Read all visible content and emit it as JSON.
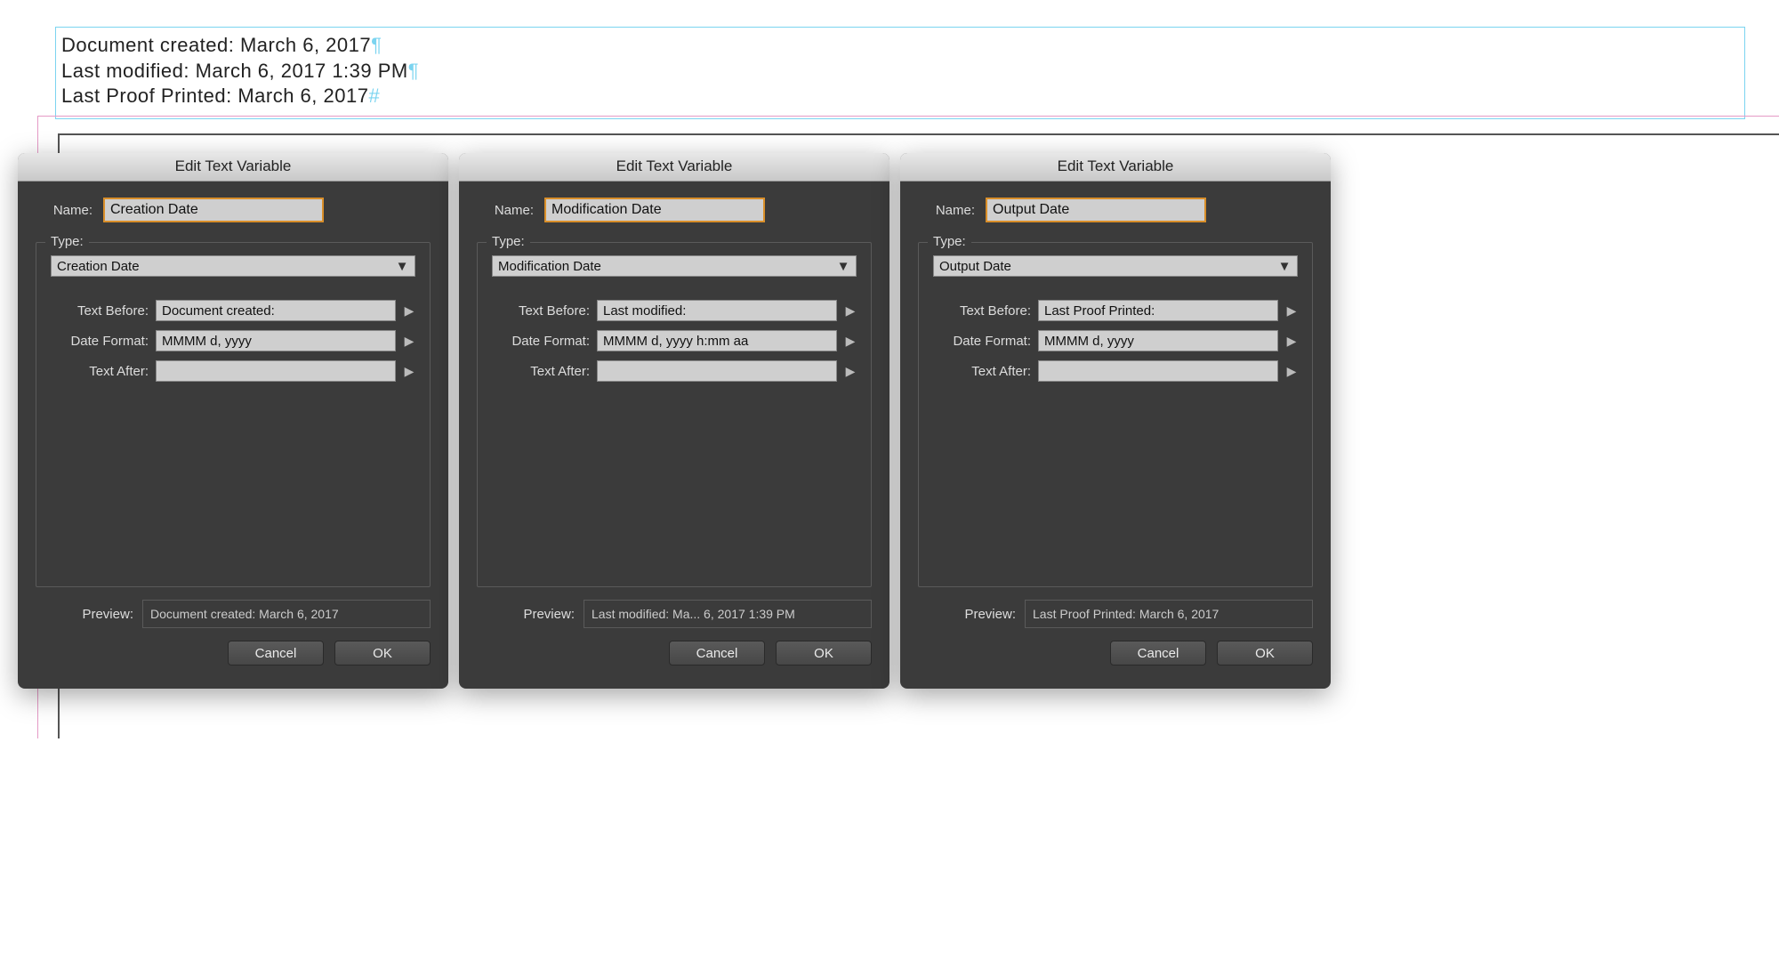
{
  "document": {
    "line1": "Document created: March 6, 2017",
    "line2": "Last modified: March 6, 2017 1:39 PM",
    "line3": "Last Proof Printed: March 6, 2017",
    "pilcrow": "¶",
    "end_mark": "#"
  },
  "dialogs": [
    {
      "title": "Edit Text Variable",
      "name_label": "Name:",
      "name_value": "Creation Date",
      "type_label": "Type:",
      "type_value": "Creation Date",
      "text_before_label": "Text Before:",
      "text_before_value": "Document created: ",
      "date_format_label": "Date Format:",
      "date_format_value": "MMMM d, yyyy",
      "text_after_label": "Text After:",
      "text_after_value": "",
      "preview_label": "Preview:",
      "preview_value": "Document created: March 6, 2017",
      "cancel": "Cancel",
      "ok": "OK"
    },
    {
      "title": "Edit Text Variable",
      "name_label": "Name:",
      "name_value": "Modification Date",
      "type_label": "Type:",
      "type_value": "Modification Date",
      "text_before_label": "Text Before:",
      "text_before_value": "Last modified: ",
      "date_format_label": "Date Format:",
      "date_format_value": "MMMM d, yyyy h:mm aa",
      "text_after_label": "Text After:",
      "text_after_value": "",
      "preview_label": "Preview:",
      "preview_value": "Last modified: Ma... 6, 2017 1:39 PM",
      "cancel": "Cancel",
      "ok": "OK"
    },
    {
      "title": "Edit Text Variable",
      "name_label": "Name:",
      "name_value": "Output Date",
      "type_label": "Type:",
      "type_value": "Output Date",
      "text_before_label": "Text Before:",
      "text_before_value": "Last Proof Printed: ",
      "date_format_label": "Date Format:",
      "date_format_value": "MMMM d, yyyy",
      "text_after_label": "Text After:",
      "text_after_value": "",
      "preview_label": "Preview:",
      "preview_value": "Last Proof Printed: March 6, 2017",
      "cancel": "Cancel",
      "ok": "OK"
    }
  ]
}
